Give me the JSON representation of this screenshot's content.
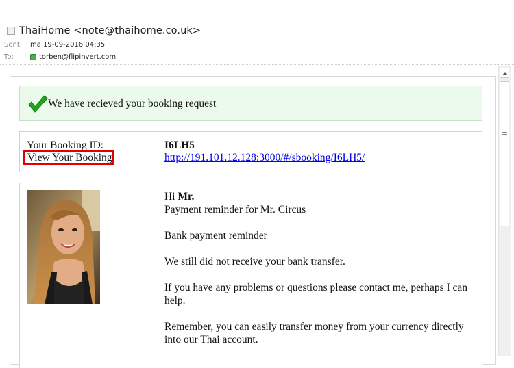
{
  "email": {
    "from": "ThaiHome <note@thaihome.co.uk>",
    "sent_label": "Sent:",
    "sent_value": "ma 19-09-2016 04:35",
    "to_label": "To:",
    "to_value": "torben@flipinvert.com"
  },
  "confirmation": {
    "icon": "checkmark-icon",
    "text": "We have recieved your booking request"
  },
  "booking": {
    "id_label": "Your Booking ID:",
    "id_value": "I6LH5",
    "view_label": "View Your Booking",
    "view_link": "http://191.101.12.128:3000/#/sbooking/I6LH5/"
  },
  "message": {
    "greeting_prefix": "Hi ",
    "greeting_name": "Mr.",
    "line1": "Payment reminder for Mr. Circus",
    "line2": "Bank payment reminder",
    "line3": "We still did not receive your bank transfer.",
    "line4": "If you have any problems or questions please contact me, perhaps I can help.",
    "line5": "Remember, you can easily transfer money from your currency directly into our Thai account."
  },
  "colors": {
    "accent_green": "#1fa51f",
    "highlight_red": "#e00000",
    "link_blue": "#0000ee"
  }
}
